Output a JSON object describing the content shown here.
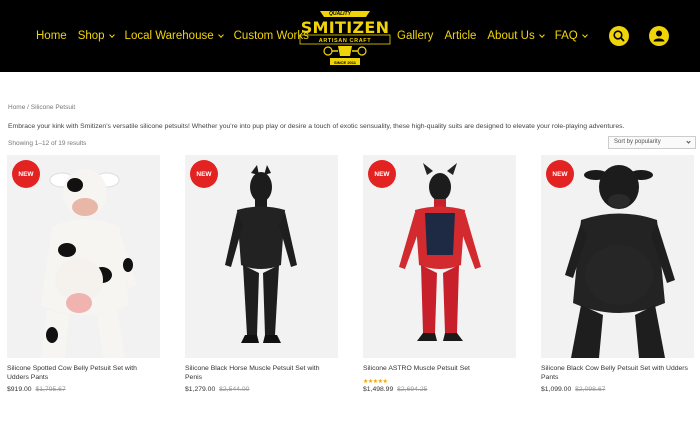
{
  "header": {
    "nav_left": [
      {
        "label": "Home",
        "has_dropdown": false
      },
      {
        "label": "Shop",
        "has_dropdown": true
      },
      {
        "label": "Local Warehouse",
        "has_dropdown": true
      },
      {
        "label": "Custom Works",
        "has_dropdown": false
      }
    ],
    "nav_right": [
      {
        "label": "Gallery",
        "has_dropdown": false
      },
      {
        "label": "Article",
        "has_dropdown": false
      },
      {
        "label": "About Us",
        "has_dropdown": true
      },
      {
        "label": "FAQ",
        "has_dropdown": true
      }
    ],
    "logo": {
      "quality": "QUALITY",
      "name": "SMITIZEN",
      "subtitle": "ARTISAN CRAFT",
      "since": "SINCE 2011"
    },
    "icons": {
      "search": "search-icon",
      "account": "user-icon"
    }
  },
  "breadcrumb": "Home / Silicone Petsuit",
  "description": "Embrace your kink with Smitizen's versatile silicone petsuits! Whether you're into pup play or desire a touch of exotic sensuality, these high-quality suits are designed to elevate your role-playing adventures.",
  "result_count": "Showing 1–12 of 19 results",
  "sort": {
    "selected": "Sort by popularity"
  },
  "badge_label": "NEW",
  "colors": {
    "accent": "#f0d40a",
    "badge": "#e32222",
    "header_bg": "#000000"
  },
  "products": [
    {
      "title": "Silicone Spotted Cow Belly Petsuit Set with Udders Pants",
      "price": "$919.00",
      "old_price": "$1,795.67",
      "rating_stars": "",
      "image": "spotted-cow-petsuit"
    },
    {
      "title": "Silicone Black Horse Muscle Petsuit Set with Penis",
      "price": "$1,279.00",
      "old_price": "$2,544.00",
      "rating_stars": "",
      "image": "black-horse-petsuit"
    },
    {
      "title": "Silicone ASTRO Muscle Petsuit Set",
      "price": "$1,498.99",
      "old_price": "$2,694.25",
      "rating_stars": "★★★★★",
      "rating": 5,
      "image": "astro-muscle-petsuit"
    },
    {
      "title": "Silicone Black Cow Belly Petsuit Set with Udders Pants",
      "price": "$1,099.00",
      "old_price": "$2,098.67",
      "rating_stars": "",
      "image": "black-cow-petsuit"
    }
  ]
}
